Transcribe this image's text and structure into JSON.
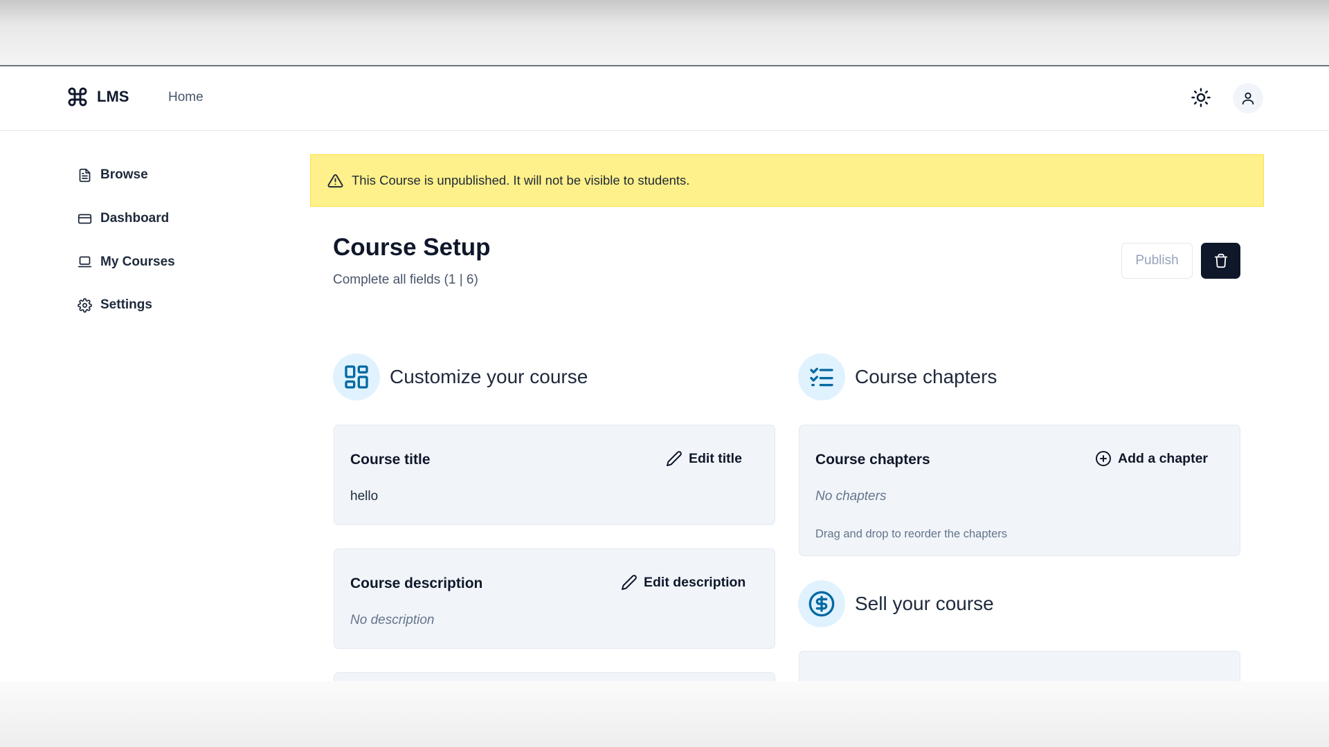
{
  "brand": {
    "name": "LMS",
    "logo_icon": "command-icon"
  },
  "nav": {
    "home": "Home"
  },
  "header": {
    "theme_icon": "sun-icon",
    "avatar_icon": "user-icon"
  },
  "sidebar": {
    "items": [
      {
        "label": "Browse",
        "icon": "file-text-icon"
      },
      {
        "label": "Dashboard",
        "icon": "credit-card-icon"
      },
      {
        "label": "My Courses",
        "icon": "laptop-icon"
      },
      {
        "label": "Settings",
        "icon": "gear-icon"
      }
    ]
  },
  "banner": {
    "text": "This Course is unpublished. It will not be visible to students.",
    "icon": "alert-triangle-icon",
    "color": "#fef08a"
  },
  "page": {
    "title": "Course Setup",
    "subtitle": "Complete all fields (1 | 6)"
  },
  "actions": {
    "publish_label": "Publish",
    "delete_icon": "trash-icon"
  },
  "sections": {
    "customize": {
      "title": "Customize your course",
      "icon": "layout-dashboard-icon"
    },
    "chapters": {
      "title": "Course chapters",
      "icon": "list-checks-icon"
    },
    "sell": {
      "title": "Sell your course",
      "icon": "circle-dollar-icon"
    }
  },
  "cards": {
    "course_title": {
      "label": "Course title",
      "action": "Edit title",
      "value": "hello"
    },
    "course_description": {
      "label": "Course description",
      "action": "Edit description",
      "value": "No description"
    },
    "course_chapters": {
      "label": "Course chapters",
      "action": "Add a chapter",
      "value": "No chapters",
      "hint": "Drag and drop to reorder the chapters"
    }
  },
  "colors": {
    "accent": "#0369a1",
    "accent_bg": "#e0f2fe",
    "dark": "#0f172a",
    "card_bg": "#f1f5f9"
  }
}
